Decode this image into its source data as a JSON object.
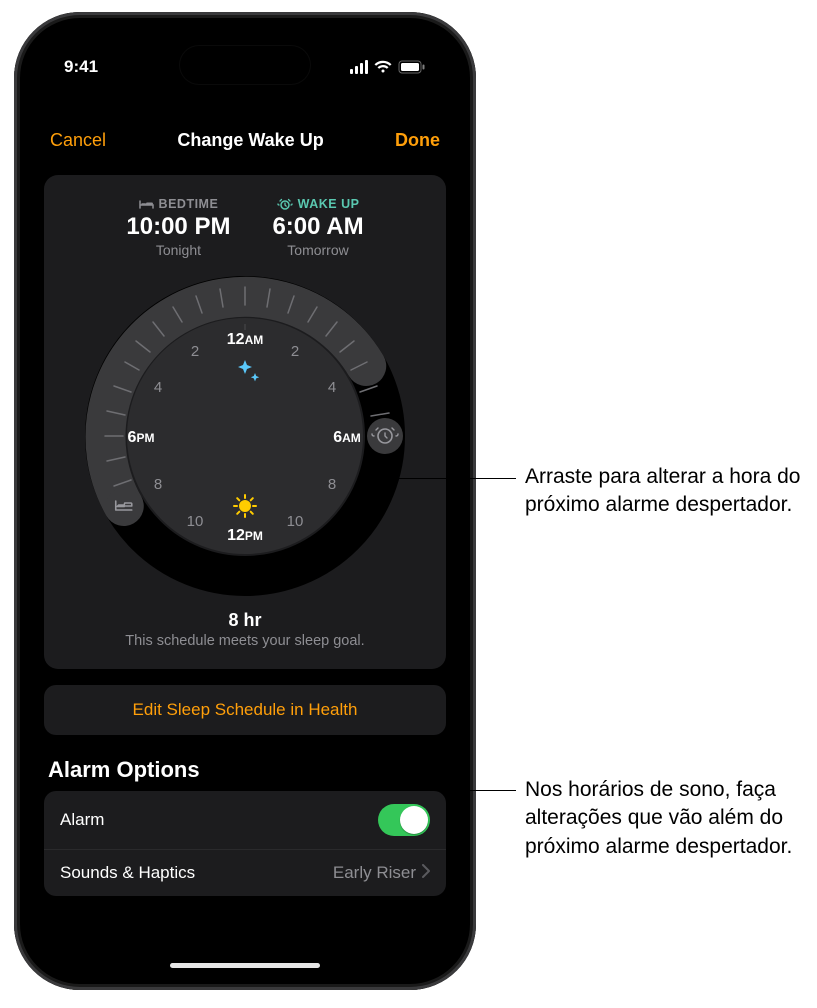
{
  "statusbar": {
    "time": "9:41"
  },
  "sheet": {
    "cancel": "Cancel",
    "title": "Change Wake Up",
    "done": "Done"
  },
  "bedtime": {
    "label": "BEDTIME",
    "time": "10:00 PM",
    "day": "Tonight"
  },
  "wakeup": {
    "label": "WAKE UP",
    "time": "6:00 AM",
    "day": "Tomorrow"
  },
  "dial": {
    "top_label_num": "12",
    "top_label_ampm": "AM",
    "right_label_num": "6",
    "right_label_ampm": "AM",
    "bottom_label_num": "12",
    "bottom_label_ampm": "PM",
    "left_label_num": "6",
    "left_label_ampm": "PM",
    "minor_2": "2",
    "minor_4": "4",
    "minor_8": "8",
    "minor_10": "10"
  },
  "summary": {
    "duration": "8 hr",
    "goal_text": "This schedule meets your sleep goal."
  },
  "edit_link": "Edit Sleep Schedule in Health",
  "section_title": "Alarm Options",
  "options": {
    "alarm_label": "Alarm",
    "sounds_label": "Sounds & Haptics",
    "sounds_value": "Early Riser"
  },
  "callouts": {
    "wake_handle": "Arraste para alterar a hora do próximo alarme despertador.",
    "edit_link": "Nos horários de sono, faça alterações que vão além do próximo alarme despertador."
  }
}
